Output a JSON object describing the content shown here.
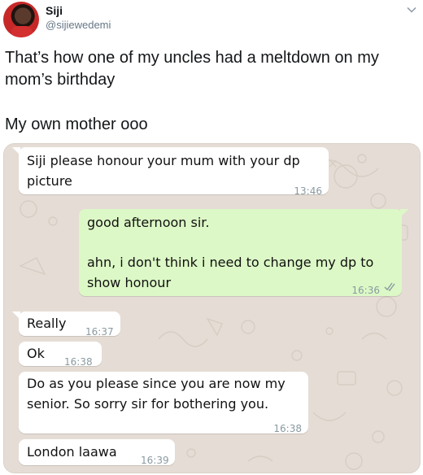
{
  "tweet": {
    "display_name": "Siji",
    "handle": "@sijiewedemi",
    "text_line1": "That’s how one of my uncles had a meltdown on my mom’s birthday",
    "text_line2": "My own mother ooo"
  },
  "chat": {
    "messages": [
      {
        "direction": "in",
        "text": "Siji please honour your mum with your dp picture",
        "time": "13:46"
      },
      {
        "direction": "out",
        "text_p1": "good afternoon sir.",
        "text_p2": "ahn, i don't think i need to change my dp to show honour",
        "time": "16:36",
        "status_icon": "double-check-icon"
      },
      {
        "direction": "in",
        "text": "Really",
        "time": "16:37"
      },
      {
        "direction": "in",
        "text": "Ok",
        "time": "16:38"
      },
      {
        "direction": "in",
        "text": "Do as you please since you are now my senior. So sorry sir for bothering you.",
        "time": "16:38"
      },
      {
        "direction": "in",
        "text": "London laawa",
        "time": "16:39"
      }
    ]
  },
  "colors": {
    "chat_bg": "#e5ddd5",
    "incoming_bubble": "#ffffff",
    "outgoing_bubble": "#dcf8c6"
  }
}
